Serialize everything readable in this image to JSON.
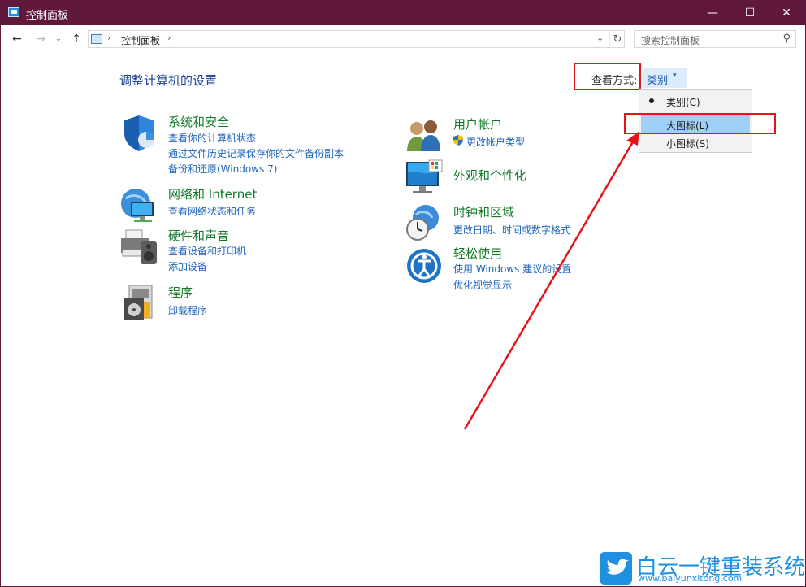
{
  "window": {
    "title": "控制面板",
    "controls": {
      "minimize": "—",
      "maximize": "☐",
      "close": "✕"
    }
  },
  "nav": {
    "back": "←",
    "forward": "→",
    "recent": "⌄",
    "up": "↑"
  },
  "address": {
    "separator": "›",
    "path": "控制面板",
    "dropdown": "⌄",
    "refresh": "↻"
  },
  "search": {
    "placeholder": "搜索控制面板",
    "icon_glyph": "⚲"
  },
  "page": {
    "heading": "调整计算机的设置"
  },
  "view_by": {
    "label": "查看方式:",
    "value": "类别",
    "caret": "▾",
    "menu": [
      {
        "label": "类别(C)",
        "selected": true
      },
      {
        "label": "大图标(L)",
        "hovered": true
      },
      {
        "label": "小图标(S)"
      }
    ]
  },
  "categories_left": [
    {
      "title": "系统和安全",
      "links": [
        "查看你的计算机状态",
        "通过文件历史记录保存你的文件备份副本",
        "备份和还原(Windows 7)"
      ],
      "icon": "shield-icon"
    },
    {
      "title": "网络和 Internet",
      "links": [
        "查看网络状态和任务"
      ],
      "icon": "network-icon"
    },
    {
      "title": "硬件和声音",
      "links": [
        "查看设备和打印机",
        "添加设备"
      ],
      "icon": "printer-icon"
    },
    {
      "title": "程序",
      "links": [
        "卸载程序"
      ],
      "icon": "programs-icon"
    }
  ],
  "categories_right": [
    {
      "title": "用户帐户",
      "links": [
        "更改帐户类型"
      ],
      "icon": "users-icon"
    },
    {
      "title": "外观和个性化",
      "links": [],
      "icon": "monitor-icon"
    },
    {
      "title": "时钟和区域",
      "links": [
        "更改日期、时间或数字格式"
      ],
      "icon": "clock-icon"
    },
    {
      "title": "轻松使用",
      "links": [
        "使用 Windows 建议的设置",
        "优化视觉显示"
      ],
      "icon": "ease-of-access-icon"
    }
  ],
  "watermark": {
    "main": "白云一键重装系统",
    "sub": "www.baiyunxitong.com"
  },
  "colors": {
    "titlebar": "#5f173a",
    "link": "#2066bb",
    "category_title": "#137a2a",
    "heading": "#1c3f94",
    "annotation": "#e3141b",
    "menu_hover": "#9fd0f7"
  }
}
